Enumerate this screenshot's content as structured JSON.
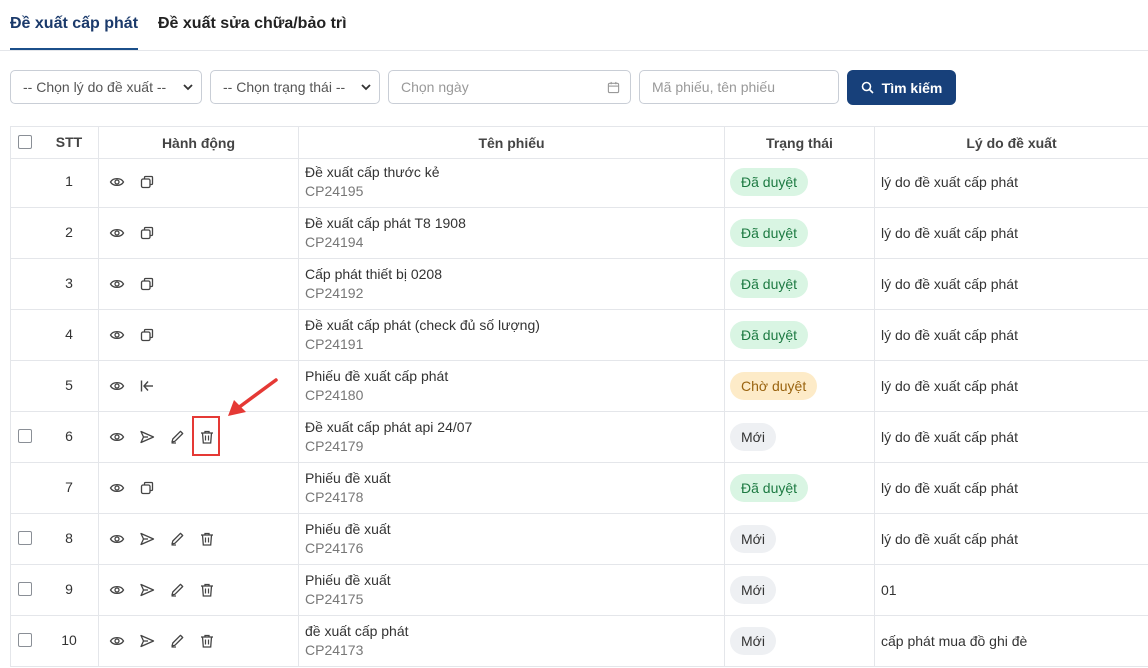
{
  "tabs": [
    "Đề xuất cấp phát",
    "Đề xuất sửa chữa/bảo trì"
  ],
  "filters": {
    "reason_select": "-- Chọn lý do đề xuất --",
    "status_select": "-- Chọn trạng thái --",
    "date_placeholder": "Chọn ngày",
    "search_placeholder": "Mã phiếu, tên phiếu",
    "search_button": "Tìm kiếm"
  },
  "table": {
    "headers": {
      "stt": "STT",
      "actions": "Hành động",
      "name": "Tên phiếu",
      "status": "Trạng thái",
      "reason": "Lý do đề xuất"
    },
    "rows": [
      {
        "stt": "1",
        "name": "Đề xuất cấp thước kẻ",
        "code": "CP24195",
        "status": "Đã duyệt",
        "reason": "lý do đề xuất cấp phát"
      },
      {
        "stt": "2",
        "name": "Đề xuất cấp phát T8 1908",
        "code": "CP24194",
        "status": "Đã duyệt",
        "reason": "lý do đề xuất cấp phát"
      },
      {
        "stt": "3",
        "name": "Cấp phát thiết bị 0208",
        "code": "CP24192",
        "status": "Đã duyệt",
        "reason": "lý do đề xuất cấp phát"
      },
      {
        "stt": "4",
        "name": "Đề xuất cấp phát (check đủ số lượng)",
        "code": "CP24191",
        "status": "Đã duyệt",
        "reason": "lý do đề xuất cấp phát"
      },
      {
        "stt": "5",
        "name": "Phiếu đề xuất cấp phát",
        "code": "CP24180",
        "status": "Chờ duyệt",
        "reason": "lý do đề xuất cấp phát"
      },
      {
        "stt": "6",
        "name": "Đề xuất cấp phát api 24/07",
        "code": "CP24179",
        "status": "Mới",
        "reason": "lý do đề xuất cấp phát"
      },
      {
        "stt": "7",
        "name": "Phiếu đề xuất",
        "code": "CP24178",
        "status": "Đã duyệt",
        "reason": "lý do đề xuất cấp phát"
      },
      {
        "stt": "8",
        "name": "Phiếu đề xuất",
        "code": "CP24176",
        "status": "Mới",
        "reason": "lý do đề xuất cấp phát"
      },
      {
        "stt": "9",
        "name": "Phiếu đề xuất",
        "code": "CP24175",
        "status": "Mới",
        "reason": "01"
      },
      {
        "stt": "10",
        "name": "đề xuất cấp phát",
        "code": "CP24173",
        "status": "Mới",
        "reason": "cấp phát mua đồ ghi đè"
      }
    ]
  },
  "colors": {
    "primary": "#17407a",
    "approved_bg": "#d9f5e3",
    "waiting_bg": "#fdebc8",
    "new_bg": "#eef0f3",
    "highlight": "#e53935"
  }
}
